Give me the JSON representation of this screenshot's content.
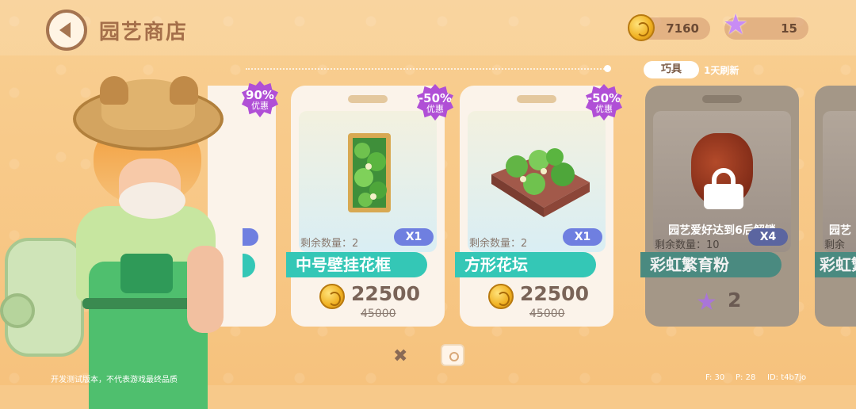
{
  "header": {
    "title": "园艺商店",
    "coins": "7160",
    "stars": "15"
  },
  "shop": {
    "tab_label": "巧具",
    "refresh": "1天刷新",
    "left_partial": {
      "pct": "90%",
      "label": "优惠"
    },
    "cards": [
      {
        "discount": "-50%",
        "discount_label": "优惠",
        "remaining": "剩余数量：2",
        "qty": "X1",
        "name": "中号壁挂花框",
        "price": "22500",
        "old_price": "45000"
      },
      {
        "discount": "-50%",
        "discount_label": "优惠",
        "remaining": "剩余数量：2",
        "qty": "X1",
        "name": "方形花坛",
        "price": "22500",
        "old_price": "45000"
      },
      {
        "locked": true,
        "lock_text": "园艺爱好达到6后解锁",
        "remaining": "剩余数量：10",
        "qty": "X4",
        "name": "彩虹繁育粉",
        "price": "2"
      },
      {
        "locked": true,
        "lock_text": "园艺",
        "remaining": "剩余",
        "name": "彩虹繁"
      }
    ]
  },
  "footer": {
    "note": "开发测试版本，不代表游戏最终品质",
    "fps": "F: 30",
    "ping": "P: 28",
    "id": "ID: t4b7jo"
  }
}
